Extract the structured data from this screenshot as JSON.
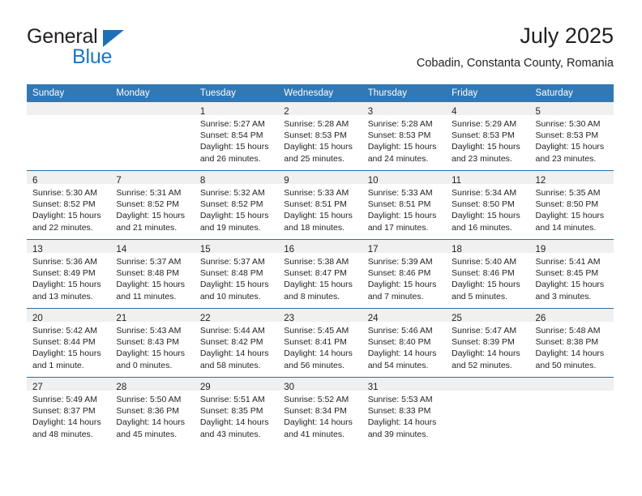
{
  "brand": {
    "word_one": "General",
    "word_two": "Blue",
    "triangle_icon": "brand-triangle-icon",
    "accent_color": "#1877c9"
  },
  "header": {
    "title": "July 2025",
    "location": "Cobadin, Constanta County, Romania"
  },
  "colors": {
    "header_row_bg": "#3178b4",
    "header_row_text": "#ffffff",
    "cell_rule": "#2e6da4",
    "daynum_band": "#f0f0f0",
    "text": "#231f20"
  },
  "weekday_headers": [
    "Sunday",
    "Monday",
    "Tuesday",
    "Wednesday",
    "Thursday",
    "Friday",
    "Saturday"
  ],
  "weeks": [
    [
      {
        "day": "",
        "empty": true
      },
      {
        "day": "",
        "empty": true
      },
      {
        "day": "1",
        "sunrise": "Sunrise: 5:27 AM",
        "sunset": "Sunset: 8:54 PM",
        "daylight_line1": "Daylight: 15 hours",
        "daylight_line2": "and 26 minutes."
      },
      {
        "day": "2",
        "sunrise": "Sunrise: 5:28 AM",
        "sunset": "Sunset: 8:53 PM",
        "daylight_line1": "Daylight: 15 hours",
        "daylight_line2": "and 25 minutes."
      },
      {
        "day": "3",
        "sunrise": "Sunrise: 5:28 AM",
        "sunset": "Sunset: 8:53 PM",
        "daylight_line1": "Daylight: 15 hours",
        "daylight_line2": "and 24 minutes."
      },
      {
        "day": "4",
        "sunrise": "Sunrise: 5:29 AM",
        "sunset": "Sunset: 8:53 PM",
        "daylight_line1": "Daylight: 15 hours",
        "daylight_line2": "and 23 minutes."
      },
      {
        "day": "5",
        "sunrise": "Sunrise: 5:30 AM",
        "sunset": "Sunset: 8:53 PM",
        "daylight_line1": "Daylight: 15 hours",
        "daylight_line2": "and 23 minutes."
      }
    ],
    [
      {
        "day": "6",
        "sunrise": "Sunrise: 5:30 AM",
        "sunset": "Sunset: 8:52 PM",
        "daylight_line1": "Daylight: 15 hours",
        "daylight_line2": "and 22 minutes."
      },
      {
        "day": "7",
        "sunrise": "Sunrise: 5:31 AM",
        "sunset": "Sunset: 8:52 PM",
        "daylight_line1": "Daylight: 15 hours",
        "daylight_line2": "and 21 minutes."
      },
      {
        "day": "8",
        "sunrise": "Sunrise: 5:32 AM",
        "sunset": "Sunset: 8:52 PM",
        "daylight_line1": "Daylight: 15 hours",
        "daylight_line2": "and 19 minutes."
      },
      {
        "day": "9",
        "sunrise": "Sunrise: 5:33 AM",
        "sunset": "Sunset: 8:51 PM",
        "daylight_line1": "Daylight: 15 hours",
        "daylight_line2": "and 18 minutes."
      },
      {
        "day": "10",
        "sunrise": "Sunrise: 5:33 AM",
        "sunset": "Sunset: 8:51 PM",
        "daylight_line1": "Daylight: 15 hours",
        "daylight_line2": "and 17 minutes."
      },
      {
        "day": "11",
        "sunrise": "Sunrise: 5:34 AM",
        "sunset": "Sunset: 8:50 PM",
        "daylight_line1": "Daylight: 15 hours",
        "daylight_line2": "and 16 minutes."
      },
      {
        "day": "12",
        "sunrise": "Sunrise: 5:35 AM",
        "sunset": "Sunset: 8:50 PM",
        "daylight_line1": "Daylight: 15 hours",
        "daylight_line2": "and 14 minutes."
      }
    ],
    [
      {
        "day": "13",
        "sunrise": "Sunrise: 5:36 AM",
        "sunset": "Sunset: 8:49 PM",
        "daylight_line1": "Daylight: 15 hours",
        "daylight_line2": "and 13 minutes."
      },
      {
        "day": "14",
        "sunrise": "Sunrise: 5:37 AM",
        "sunset": "Sunset: 8:48 PM",
        "daylight_line1": "Daylight: 15 hours",
        "daylight_line2": "and 11 minutes."
      },
      {
        "day": "15",
        "sunrise": "Sunrise: 5:37 AM",
        "sunset": "Sunset: 8:48 PM",
        "daylight_line1": "Daylight: 15 hours",
        "daylight_line2": "and 10 minutes."
      },
      {
        "day": "16",
        "sunrise": "Sunrise: 5:38 AM",
        "sunset": "Sunset: 8:47 PM",
        "daylight_line1": "Daylight: 15 hours",
        "daylight_line2": "and 8 minutes."
      },
      {
        "day": "17",
        "sunrise": "Sunrise: 5:39 AM",
        "sunset": "Sunset: 8:46 PM",
        "daylight_line1": "Daylight: 15 hours",
        "daylight_line2": "and 7 minutes."
      },
      {
        "day": "18",
        "sunrise": "Sunrise: 5:40 AM",
        "sunset": "Sunset: 8:46 PM",
        "daylight_line1": "Daylight: 15 hours",
        "daylight_line2": "and 5 minutes."
      },
      {
        "day": "19",
        "sunrise": "Sunrise: 5:41 AM",
        "sunset": "Sunset: 8:45 PM",
        "daylight_line1": "Daylight: 15 hours",
        "daylight_line2": "and 3 minutes."
      }
    ],
    [
      {
        "day": "20",
        "sunrise": "Sunrise: 5:42 AM",
        "sunset": "Sunset: 8:44 PM",
        "daylight_line1": "Daylight: 15 hours",
        "daylight_line2": "and 1 minute."
      },
      {
        "day": "21",
        "sunrise": "Sunrise: 5:43 AM",
        "sunset": "Sunset: 8:43 PM",
        "daylight_line1": "Daylight: 15 hours",
        "daylight_line2": "and 0 minutes."
      },
      {
        "day": "22",
        "sunrise": "Sunrise: 5:44 AM",
        "sunset": "Sunset: 8:42 PM",
        "daylight_line1": "Daylight: 14 hours",
        "daylight_line2": "and 58 minutes."
      },
      {
        "day": "23",
        "sunrise": "Sunrise: 5:45 AM",
        "sunset": "Sunset: 8:41 PM",
        "daylight_line1": "Daylight: 14 hours",
        "daylight_line2": "and 56 minutes."
      },
      {
        "day": "24",
        "sunrise": "Sunrise: 5:46 AM",
        "sunset": "Sunset: 8:40 PM",
        "daylight_line1": "Daylight: 14 hours",
        "daylight_line2": "and 54 minutes."
      },
      {
        "day": "25",
        "sunrise": "Sunrise: 5:47 AM",
        "sunset": "Sunset: 8:39 PM",
        "daylight_line1": "Daylight: 14 hours",
        "daylight_line2": "and 52 minutes."
      },
      {
        "day": "26",
        "sunrise": "Sunrise: 5:48 AM",
        "sunset": "Sunset: 8:38 PM",
        "daylight_line1": "Daylight: 14 hours",
        "daylight_line2": "and 50 minutes."
      }
    ],
    [
      {
        "day": "27",
        "sunrise": "Sunrise: 5:49 AM",
        "sunset": "Sunset: 8:37 PM",
        "daylight_line1": "Daylight: 14 hours",
        "daylight_line2": "and 48 minutes."
      },
      {
        "day": "28",
        "sunrise": "Sunrise: 5:50 AM",
        "sunset": "Sunset: 8:36 PM",
        "daylight_line1": "Daylight: 14 hours",
        "daylight_line2": "and 45 minutes."
      },
      {
        "day": "29",
        "sunrise": "Sunrise: 5:51 AM",
        "sunset": "Sunset: 8:35 PM",
        "daylight_line1": "Daylight: 14 hours",
        "daylight_line2": "and 43 minutes."
      },
      {
        "day": "30",
        "sunrise": "Sunrise: 5:52 AM",
        "sunset": "Sunset: 8:34 PM",
        "daylight_line1": "Daylight: 14 hours",
        "daylight_line2": "and 41 minutes."
      },
      {
        "day": "31",
        "sunrise": "Sunrise: 5:53 AM",
        "sunset": "Sunset: 8:33 PM",
        "daylight_line1": "Daylight: 14 hours",
        "daylight_line2": "and 39 minutes."
      },
      {
        "day": "",
        "empty": true
      },
      {
        "day": "",
        "empty": true
      }
    ]
  ]
}
